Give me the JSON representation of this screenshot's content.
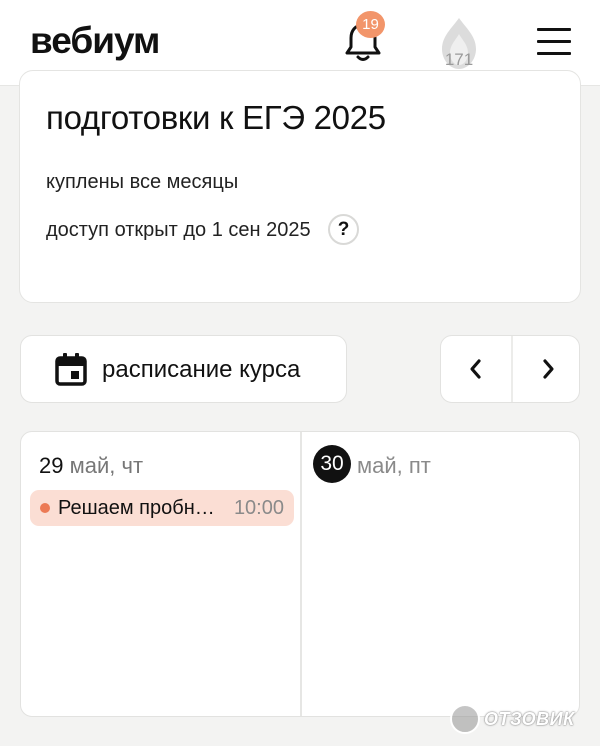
{
  "header": {
    "logo": "вебиум",
    "notifications_count": "19",
    "streak_count": "171",
    "icons": [
      "bell-icon",
      "flame-icon",
      "menu-icon"
    ]
  },
  "course_card": {
    "title_line": "подготовки к ЕГЭ 2025",
    "bought_text": "куплены все месяцы",
    "access_text": "доступ открыт до 1 сен 2025",
    "help_label": "?"
  },
  "schedule": {
    "button_label": "расписание курса",
    "icons": [
      "calendar-icon",
      "chevron-left-icon",
      "chevron-right-icon"
    ]
  },
  "calendar": {
    "days": [
      {
        "day_number": "29",
        "day_rest": "май, чт",
        "events": [
          {
            "title": "Решаем пробн…",
            "time": "10:00"
          }
        ]
      },
      {
        "day_number": "30",
        "day_rest": "май, пт",
        "is_today": true,
        "events": []
      }
    ]
  },
  "watermark": {
    "text": "ОТЗОВИК"
  },
  "colors": {
    "accent": "#f2956a",
    "event_bg": "#fbded4",
    "event_dot": "#ec7a55",
    "background": "#f3f3f2"
  }
}
